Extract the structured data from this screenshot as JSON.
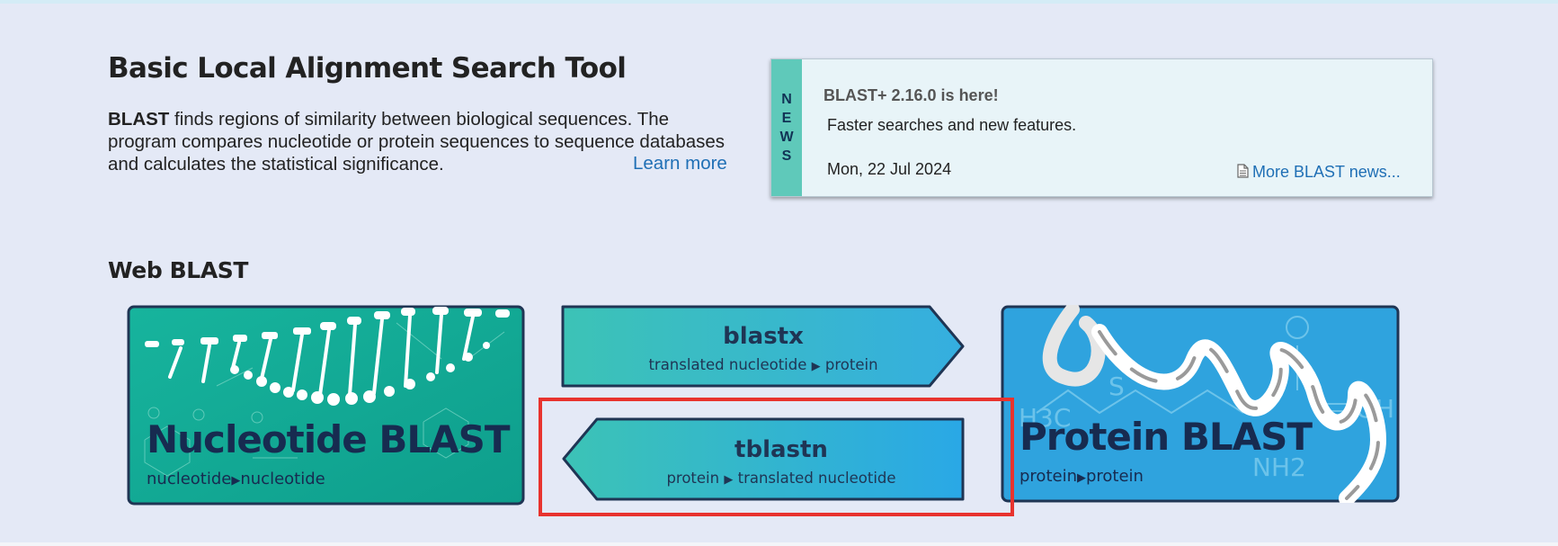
{
  "header": {
    "title": "Basic Local Alignment Search Tool",
    "intro_bold": "BLAST",
    "intro_text": " finds regions of similarity between biological sequences. The program compares nucleotide or protein sequences to sequence databases and calculates the statistical significance.",
    "learn_more": "Learn more"
  },
  "news": {
    "tab_letters": [
      "N",
      "E",
      "W",
      "S"
    ],
    "headline": "BLAST+ 2.16.0 is here!",
    "text": "Faster searches and new features.",
    "date": "Mon, 22 Jul 2024",
    "more_link": "More BLAST news..."
  },
  "web_blast": {
    "title": "Web BLAST",
    "nucleotide": {
      "title": "Nucleotide BLAST",
      "from": "nucleotide",
      "to": "nucleotide"
    },
    "blastx": {
      "title": "blastx",
      "from": "translated nucleotide",
      "to": "protein"
    },
    "tblastn": {
      "title": "tblastn",
      "from": "protein",
      "to": "translated nucleotide"
    },
    "protein": {
      "title": "Protein BLAST",
      "from": "protein",
      "to": "protein"
    },
    "arrow_glyph": "▶"
  },
  "colors": {
    "background": "#e4e9f6",
    "link": "#1f6fb5",
    "news_tab": "#5fc9ba",
    "card_border": "#1f3554",
    "highlight": "#e8332e"
  }
}
